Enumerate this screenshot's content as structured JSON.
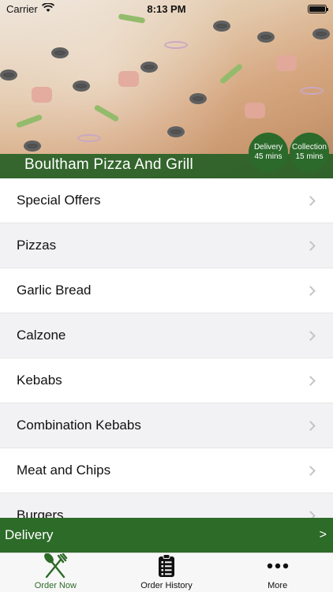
{
  "status_bar": {
    "carrier": "Carrier",
    "time": "8:13 PM"
  },
  "header": {
    "restaurant_name": "Boultham Pizza And Grill",
    "delivery_badge": {
      "label": "Delivery",
      "time": "45 mins"
    },
    "collection_badge": {
      "label": "Collection",
      "time": "15 mins"
    }
  },
  "menu": {
    "items": [
      {
        "label": "Special Offers"
      },
      {
        "label": "Pizzas"
      },
      {
        "label": "Garlic Bread"
      },
      {
        "label": "Calzone"
      },
      {
        "label": "Kebabs"
      },
      {
        "label": "Combination Kebabs"
      },
      {
        "label": "Meat and Chips"
      },
      {
        "label": "Burgers"
      }
    ]
  },
  "delivery_bar": {
    "label": "Delivery",
    "arrow": ">"
  },
  "tab_bar": {
    "tabs": [
      {
        "label": "Order Now",
        "icon": "fork-knife-icon"
      },
      {
        "label": "Order History",
        "icon": "clipboard-icon"
      },
      {
        "label": "More",
        "icon": "more-dots-icon"
      }
    ]
  },
  "colors": {
    "brand_green": "#2d6b28",
    "badge_green": "#2b6a2b"
  }
}
